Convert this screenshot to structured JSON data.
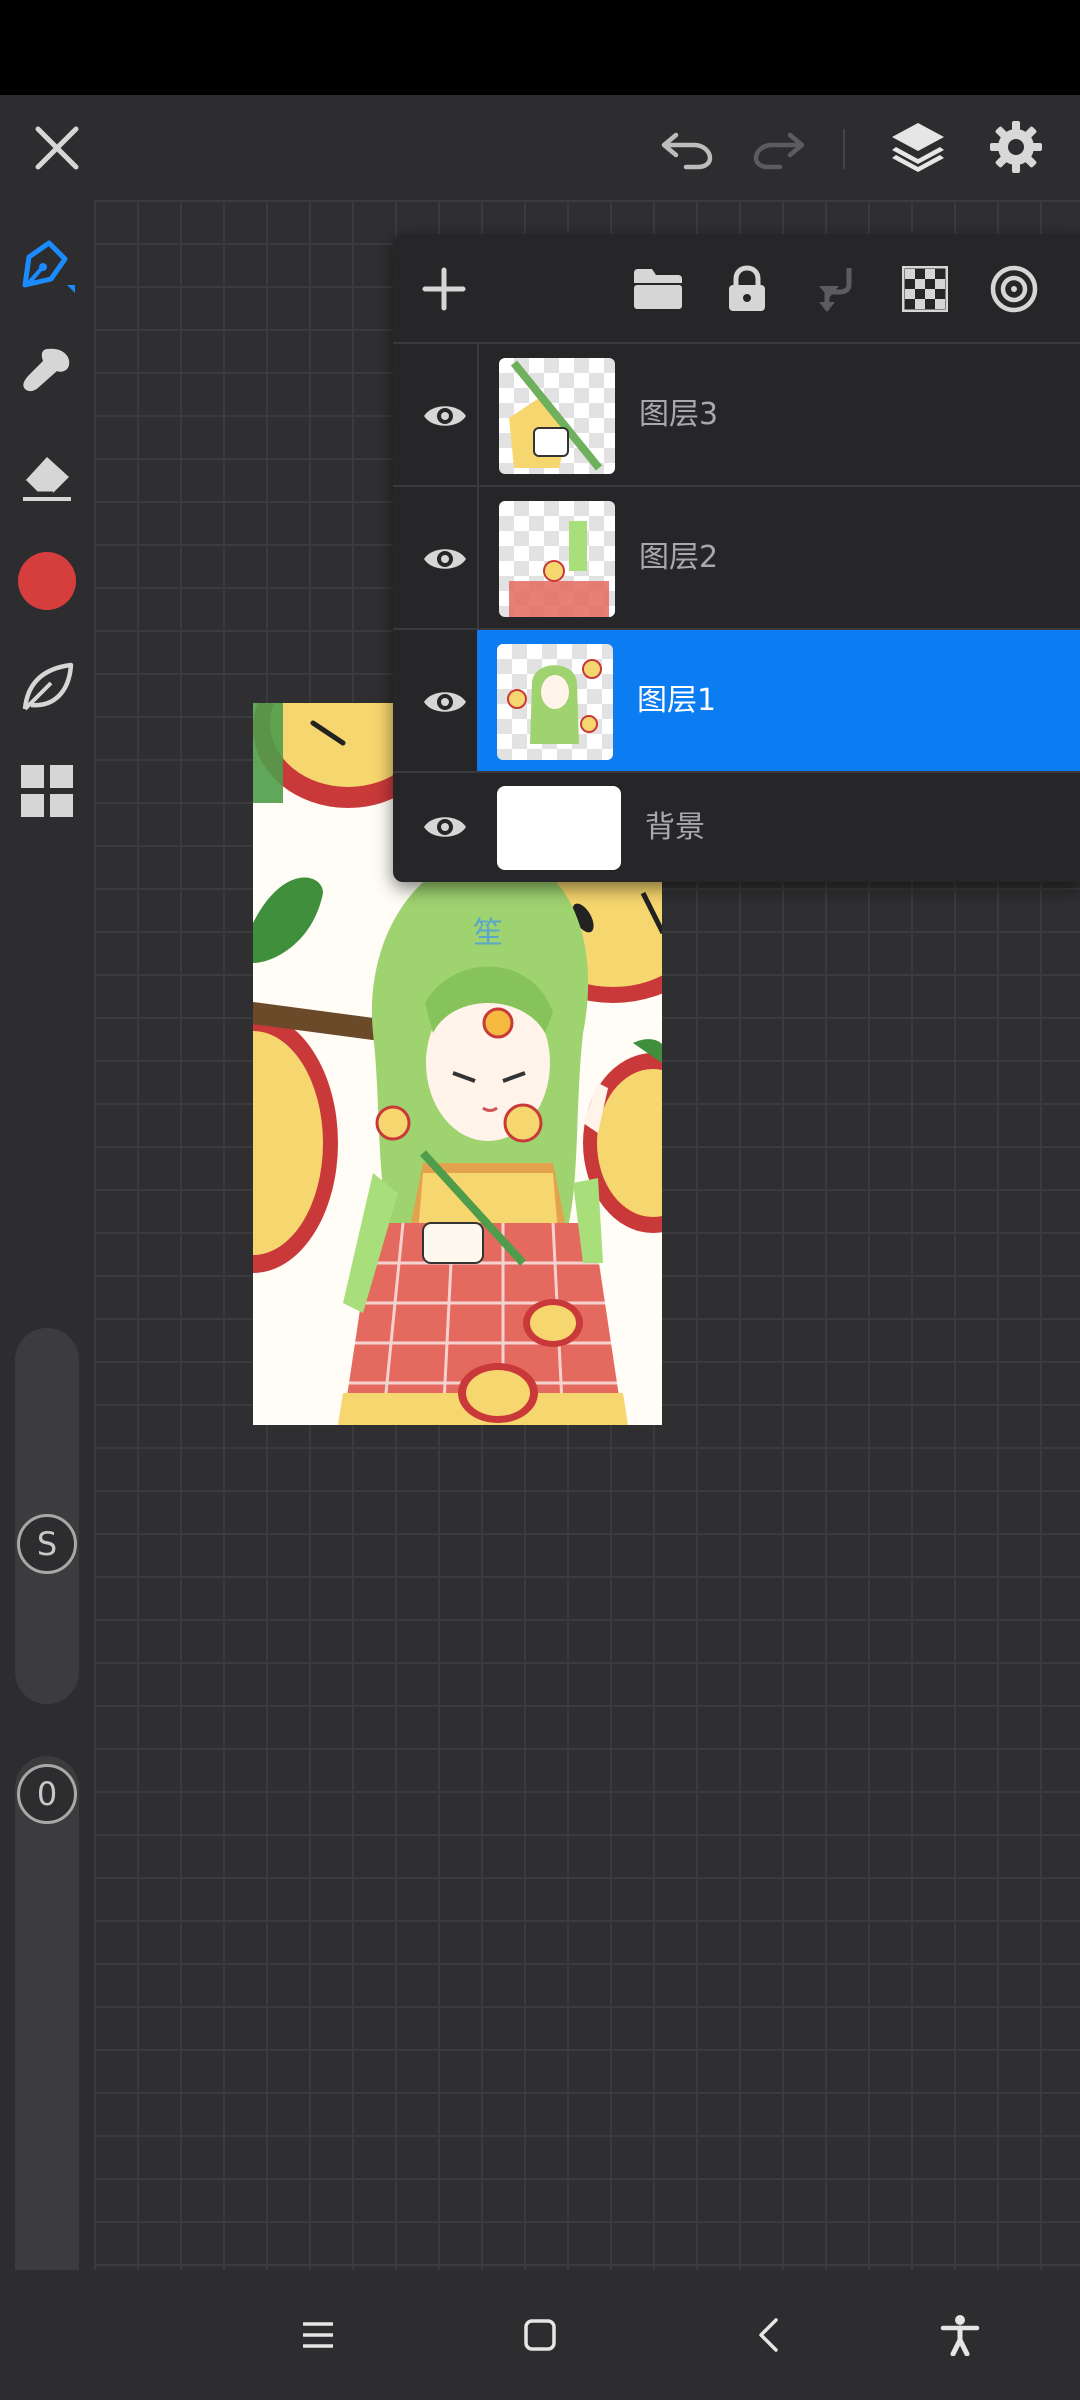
{
  "window": {
    "status_bar_color": "#000000",
    "theme": "dark"
  },
  "top_bar": {
    "close_icon": "close-icon",
    "undo_icon": "undo-icon",
    "redo_icon": "redo-icon",
    "redo_enabled": false,
    "layers_icon": "layers-icon",
    "settings_icon": "gear-icon"
  },
  "side_toolbar": {
    "tools": [
      {
        "name": "pen",
        "icon": "pen-icon",
        "active": true
      },
      {
        "name": "smudge",
        "icon": "smudge-icon"
      },
      {
        "name": "eraser",
        "icon": "eraser-icon"
      },
      {
        "name": "color",
        "icon": "color-swatch",
        "color": "#d63d3d"
      },
      {
        "name": "brush-library",
        "icon": "leaf-icon"
      },
      {
        "name": "gallery",
        "icon": "grid-icon"
      }
    ],
    "size_slider": {
      "knob_label": "S"
    },
    "opacity_slider": {
      "knob_label": "0"
    }
  },
  "layers_panel": {
    "toolbar": [
      {
        "name": "add-layer",
        "icon": "plus-icon"
      },
      {
        "name": "folder",
        "icon": "folder-icon"
      },
      {
        "name": "lock",
        "icon": "lock-icon"
      },
      {
        "name": "merge-down",
        "icon": "merge-down-icon",
        "enabled": false
      },
      {
        "name": "alpha-lock",
        "icon": "checker-icon"
      },
      {
        "name": "target",
        "icon": "target-icon"
      }
    ],
    "layers": [
      {
        "label": "图层3",
        "visible": true,
        "selected": false
      },
      {
        "label": "图层2",
        "visible": true,
        "selected": false
      },
      {
        "label": "图层1",
        "visible": true,
        "selected": true
      },
      {
        "label": "背景",
        "visible": true,
        "selected": false
      }
    ],
    "selected_color": "#0b7cf2"
  },
  "canvas": {
    "artwork": "anime-girl-with-apples",
    "signature_text": "笙",
    "background_color": "#2f2f31"
  },
  "nav_bar": {
    "recent_icon": "recents-icon",
    "home_icon": "home-icon",
    "back_icon": "back-icon",
    "accessibility_icon": "accessibility-icon"
  }
}
